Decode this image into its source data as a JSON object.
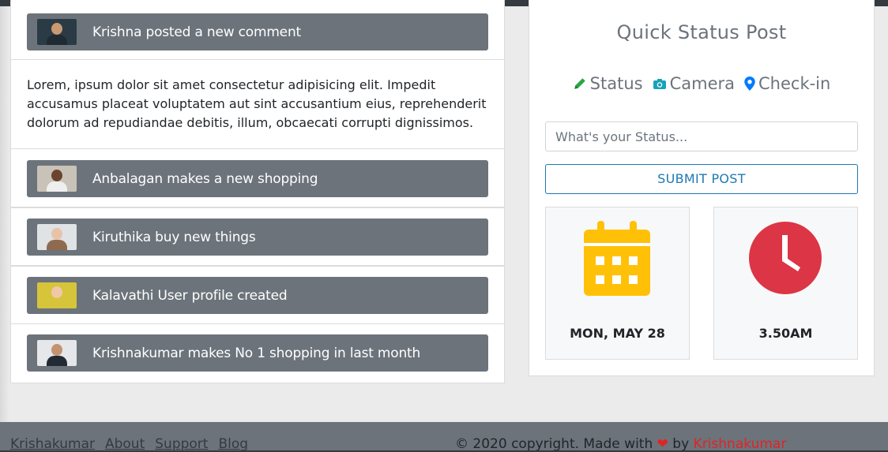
{
  "feed": {
    "items": [
      {
        "text": "Krishna posted a new comment",
        "avatar": "avatar-krishna",
        "skin": "#c99a72",
        "bg": "#2a3b45",
        "shirt": "#1f2a33"
      },
      {
        "text": "Anbalagan makes a new shopping",
        "avatar": "avatar-anbalagan",
        "skin": "#6b4430",
        "bg": "#c9c2b8",
        "shirt": "#efefef"
      },
      {
        "text": "Kiruthika buy new things",
        "avatar": "avatar-kiruthika",
        "skin": "#e8c3a8",
        "bg": "#dfe3e6",
        "shirt": "#8e6b4f"
      },
      {
        "text": "Kalavathi User profile created",
        "avatar": "avatar-kalavathi",
        "skin": "#f0c8a8",
        "bg": "#d6c43b",
        "shirt": "#d6c43b"
      },
      {
        "text": "Krishnakumar makes No 1 shopping in last month",
        "avatar": "avatar-krishnakumar",
        "skin": "#c4926e",
        "bg": "#e5e7ea",
        "shirt": "#222a33"
      }
    ],
    "comment": "Lorem, ipsum dolor sit amet consectetur adipisicing elit. Impedit accusamus placeat voluptatem aut sint accusantium eius, reprehenderit dolorum ad repudiandae debitis, illum, obcaecati corrupti dignissimos."
  },
  "quick_status": {
    "title": "Quick Status Post",
    "tabs": [
      {
        "label": "Status",
        "icon": "pencil-icon",
        "color": "#28a745"
      },
      {
        "label": "Camera",
        "icon": "camera-icon",
        "color": "#17a2b8"
      },
      {
        "label": "Check-in",
        "icon": "map-marker-icon",
        "color": "#007bff"
      }
    ],
    "input_placeholder": "What's your Status...",
    "submit_label": "SUBMIT POST",
    "date_label": "MON, MAY 28",
    "time_label": "3.50AM",
    "calendar_color": "#ffc107",
    "clock_color": "#dc3545"
  },
  "footer": {
    "links": [
      "Krishakumar",
      "About",
      "Support",
      "Blog"
    ],
    "copyright_prefix": "© 2020 copyright. Made with",
    "copyright_by": "by",
    "author": "Krishnakumar"
  }
}
